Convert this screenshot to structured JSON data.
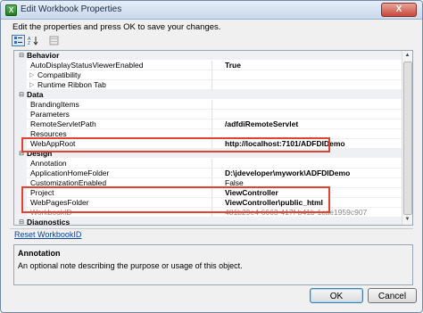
{
  "window": {
    "title": "Edit Workbook Properties",
    "close_glyph": "X",
    "app_icon_glyph": "X"
  },
  "instructions": "Edit the properties and press OK to save your changes.",
  "toolbar": {
    "categorized_icon": "categorized-icon",
    "alphabetical_icon": "alphabetical-icon",
    "property_pages_icon": "property-pages-icon"
  },
  "grid": {
    "rows": [
      {
        "kind": "category",
        "toggle": "⊟",
        "name": "Behavior"
      },
      {
        "kind": "prop",
        "name": "AutoDisplayStatusViewerEnabled",
        "value": "True"
      },
      {
        "kind": "prop",
        "expander": "▷",
        "name": "Compatibility",
        "value": ""
      },
      {
        "kind": "prop",
        "expander": "▷",
        "name": "Runtime Ribbon Tab",
        "value": ""
      },
      {
        "kind": "category",
        "toggle": "⊟",
        "name": "Data"
      },
      {
        "kind": "prop",
        "name": "BrandingItems",
        "value": ""
      },
      {
        "kind": "prop",
        "name": "Parameters",
        "value": ""
      },
      {
        "kind": "prop",
        "name": "RemoteServletPath",
        "value": "/adfdiRemoteServlet"
      },
      {
        "kind": "prop",
        "name": "Resources",
        "value": ""
      },
      {
        "kind": "prop",
        "name": "WebAppRoot",
        "value": "http://localhost:7101/ADFDIDemo"
      },
      {
        "kind": "category",
        "toggle": "⊟",
        "name": "Design"
      },
      {
        "kind": "prop",
        "name": "Annotation",
        "value": ""
      },
      {
        "kind": "prop",
        "name": "ApplicationHomeFolder",
        "value": "D:\\jdeveloper\\mywork\\ADFDIDemo"
      },
      {
        "kind": "prop",
        "name": "CustomizationEnabled",
        "value": "False",
        "weight": "normal"
      },
      {
        "kind": "prop",
        "name": "Project",
        "value": "ViewController"
      },
      {
        "kind": "prop",
        "name": "WebPagesFolder",
        "value": "ViewController\\public_html"
      },
      {
        "kind": "prop",
        "name": "WorkbookID",
        "value": "481b29e4-6663-417f-b41b-1cae1959c907",
        "dim": true
      },
      {
        "kind": "category",
        "toggle": "⊟",
        "name": "Diagnostics"
      }
    ],
    "scroll_up_glyph": "▲",
    "scroll_down_glyph": "▼"
  },
  "highlight_color": "#e0432f",
  "reset_link": "Reset WorkbookID",
  "description": {
    "title": "Annotation",
    "text": "An optional note describing the purpose or usage of this object."
  },
  "buttons": {
    "ok": "OK",
    "cancel": "Cancel"
  }
}
